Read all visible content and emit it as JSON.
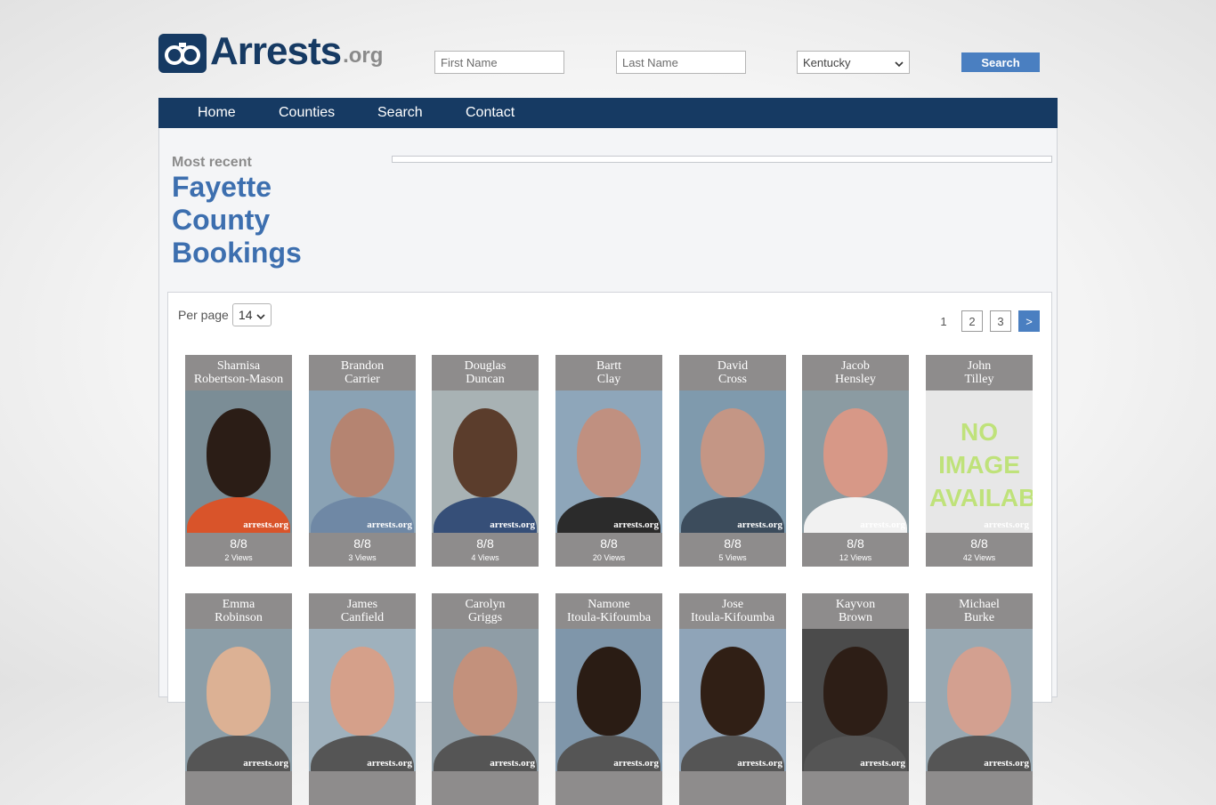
{
  "logo": {
    "main": "Arrests",
    "suffix": ".org"
  },
  "search": {
    "first_placeholder": "First Name",
    "last_placeholder": "Last Name",
    "state": "Kentucky",
    "button": "Search"
  },
  "nav": [
    "Home",
    "Counties",
    "Search",
    "Contact"
  ],
  "page": {
    "most_recent": "Most recent",
    "title_line1": "Fayette",
    "title_line2": "County",
    "title_line3": "Bookings"
  },
  "controls": {
    "per_page_label": "Per page",
    "per_page_value": "14",
    "pages": [
      "1",
      "2",
      "3"
    ],
    "next": ">"
  },
  "watermark": "arrests.org",
  "bookings": [
    {
      "first": "Sharnisa",
      "last": "Robertson-Mason",
      "date": "8/8",
      "views": "2 Views",
      "bg": "#7b8d96",
      "skin": "#2b1d16",
      "shirt": "#d9542a"
    },
    {
      "first": "Brandon",
      "last": "Carrier",
      "date": "8/8",
      "views": "3 Views",
      "bg": "#8aa2b4",
      "skin": "#b58471",
      "shirt": "#6f88a5"
    },
    {
      "first": "Douglas",
      "last": "Duncan",
      "date": "8/8",
      "views": "4 Views",
      "bg": "#a8b2b4",
      "skin": "#5b3d2c",
      "shirt": "#364f78"
    },
    {
      "first": "Bartt",
      "last": "Clay",
      "date": "8/8",
      "views": "20 Views",
      "bg": "#8ea6ba",
      "skin": "#c09080",
      "shirt": "#2b2b2b"
    },
    {
      "first": "David",
      "last": "Cross",
      "date": "8/8",
      "views": "5 Views",
      "bg": "#7f9aad",
      "skin": "#c49685",
      "shirt": "#3c4c5c"
    },
    {
      "first": "Jacob",
      "last": "Hensley",
      "date": "8/8",
      "views": "12 Views",
      "bg": "#8b9ba2",
      "skin": "#d79887",
      "shirt": "#f1f1f1"
    },
    {
      "first": "John",
      "last": "Tilley",
      "date": "8/8",
      "views": "42 Views",
      "bg": "#e7e7e7",
      "skin": "",
      "shirt": "",
      "no_image": "NO IMAGE AVAILABLE"
    },
    {
      "first": "Emma",
      "last": "Robinson",
      "date": "",
      "views": "",
      "bg": "#8c9ea8",
      "skin": "#dcb194",
      "shirt": "#555555"
    },
    {
      "first": "James",
      "last": "Canfield",
      "date": "",
      "views": "",
      "bg": "#9fb1bd",
      "skin": "#d5a08a",
      "shirt": "#555555"
    },
    {
      "first": "Carolyn",
      "last": "Griggs",
      "date": "",
      "views": "",
      "bg": "#8f9da6",
      "skin": "#c3917c",
      "shirt": "#555555"
    },
    {
      "first": "Namone",
      "last": "Itoula-Kifoumba",
      "date": "",
      "views": "",
      "bg": "#7f96aa",
      "skin": "#2a1c14",
      "shirt": "#555555"
    },
    {
      "first": "Jose",
      "last": "Itoula-Kifoumba",
      "date": "",
      "views": "",
      "bg": "#8fa4b8",
      "skin": "#301f15",
      "shirt": "#555555"
    },
    {
      "first": "Kayvon",
      "last": "Brown",
      "date": "",
      "views": "",
      "bg": "#4b4b4b",
      "skin": "#2d1e16",
      "shirt": "#555555"
    },
    {
      "first": "Michael",
      "last": "Burke",
      "date": "",
      "views": "",
      "bg": "#98a8b2",
      "skin": "#d3a090",
      "shirt": "#555555"
    }
  ],
  "colors": {
    "navy": "#163a63",
    "accent": "#4a7fc1",
    "card": "#8e8c8c",
    "title": "#3d6faf"
  }
}
